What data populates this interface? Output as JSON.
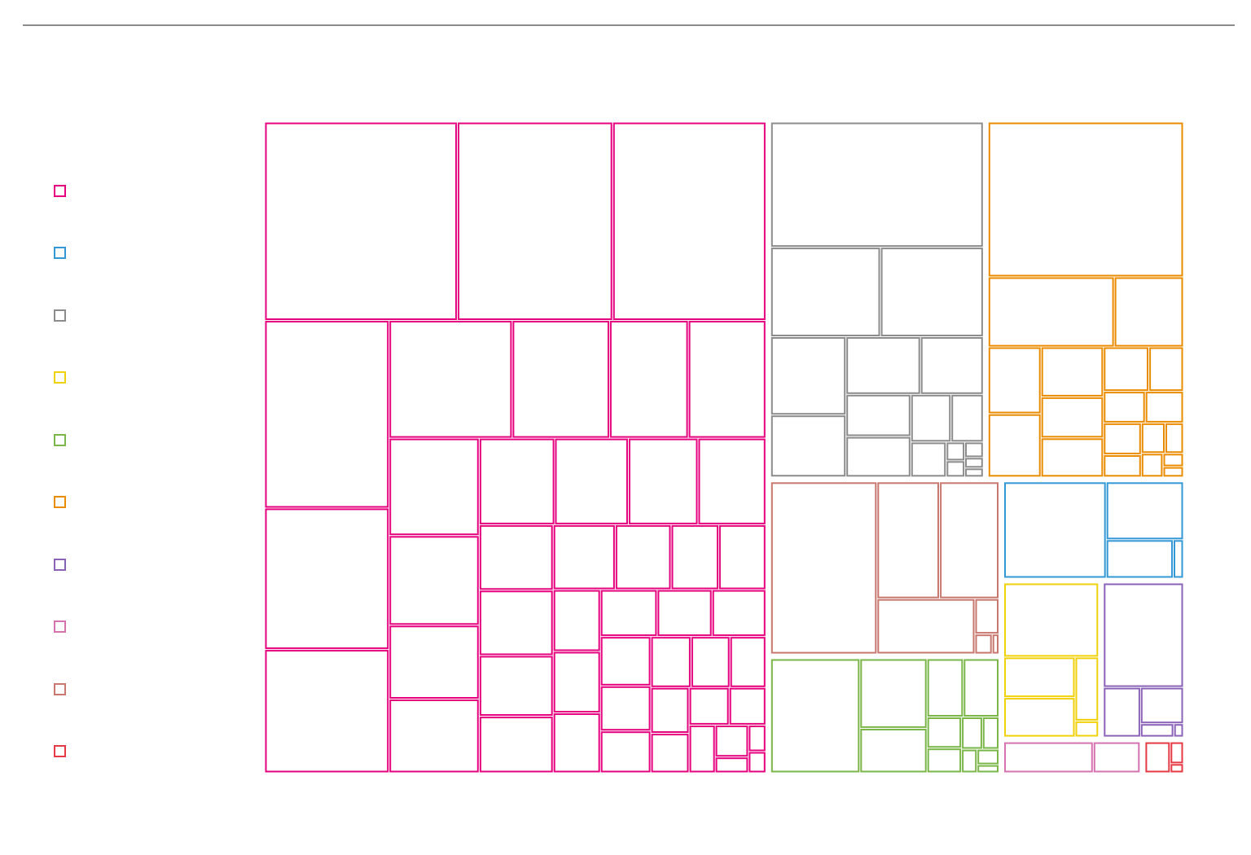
{
  "chart_data": {
    "type": "treemap",
    "title": "",
    "legend_position": "left",
    "groups": [
      {
        "name": "",
        "color": "#e6007e",
        "values": [
          5.71,
          20.03,
          0.34,
          24.84,
          11.44,
          19.75,
          2.01,
          15.18,
          9.97,
          5.94,
          4.25,
          4.32,
          1.37,
          3.15,
          1.62,
          1.29,
          5.25,
          6.03,
          1.99,
          7.46,
          1.48,
          1.19,
          2.36,
          2.92,
          2.62,
          2.72,
          9.43,
          4.33,
          4.15,
          3.82,
          3.14,
          0.98,
          1.84,
          3.92,
          1.9,
          1.14,
          0.98,
          0.9,
          1.64,
          1.67,
          1.73,
          1.33,
          1.89,
          0.81,
          0.69,
          0.3,
          0.24
        ]
      },
      {
        "name": "",
        "color": "#3399d6",
        "values": [
          6.8,
          3.08,
          0.27,
          1.78
        ]
      },
      {
        "name": "",
        "color": "#8c8c8c",
        "values": [
          1.74,
          3.09,
          2.85,
          6.51,
          6.1,
          17.63,
          1.27,
          1.81,
          3.91,
          2.4,
          0.82,
          1.02,
          0.13,
          0.2,
          0.19,
          0.23,
          0.11
        ]
      },
      {
        "name": "",
        "color": "#f0d20a",
        "values": [
          4.86,
          1.95,
          1.04,
          0.26,
          2.0
        ]
      },
      {
        "name": "",
        "color": "#7ab648",
        "values": [
          0.12,
          0.58,
          6.92,
          3.18,
          1.44,
          1.41,
          0.46,
          0.73,
          2.03,
          0.36,
          0.25,
          0.23
        ]
      },
      {
        "name": "",
        "color": "#eb8c00",
        "values": [
          2.35,
          20.06,
          5.87,
          3.22,
          0.88,
          0.8,
          0.37,
          1.62,
          0.18,
          0.14,
          0.56,
          1.7,
          1.02,
          2.22,
          1.34,
          2.07,
          0.8,
          0.34,
          0.48
        ]
      },
      {
        "name": "",
        "color": "#8a63b8",
        "values": [
          5.84,
          1.09,
          0.09,
          0.31,
          1.29
        ]
      },
      {
        "name": "",
        "color": "#d672b0",
        "values": [
          1.11,
          2.12
        ]
      },
      {
        "name": "",
        "color": "#c8786e",
        "values": [
          0.09,
          4.9,
          4.66,
          3.63,
          12.28,
          0.57,
          0.23
        ]
      },
      {
        "name": "",
        "color": "#e63946",
        "values": [
          0.24,
          0.65,
          0.1
        ]
      }
    ]
  }
}
